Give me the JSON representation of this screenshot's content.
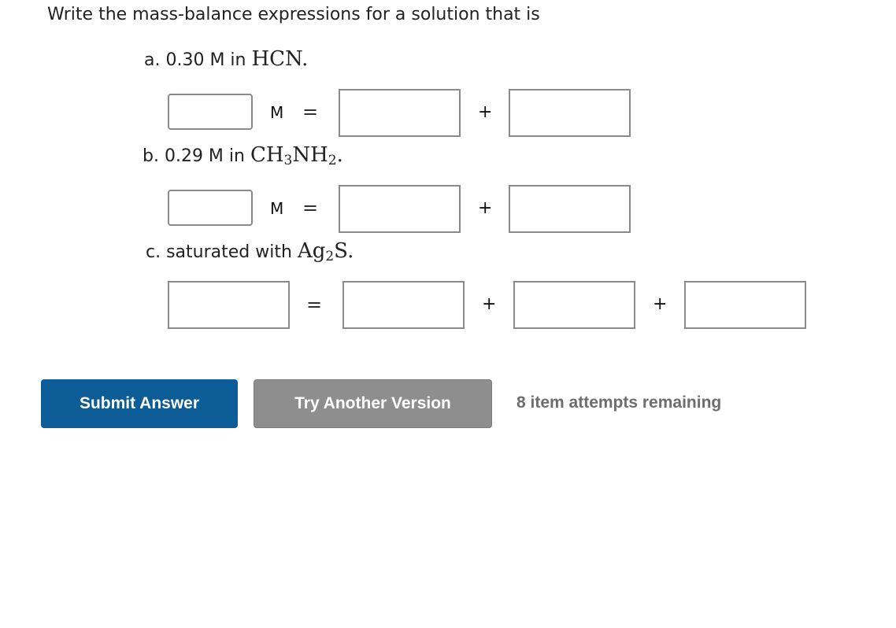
{
  "prompt": "Write the mass-balance expressions for a solution that is",
  "parts": {
    "a": {
      "label": "a. 0.30 M in ",
      "species": "HCN",
      "species_suffix": ".",
      "unit": "M",
      "equals": "=",
      "plus": "+"
    },
    "b": {
      "label": "b. 0.29 M in ",
      "species_part1": "CH",
      "species_sub1": "3",
      "species_part2": "NH",
      "species_sub2": "2",
      "species_suffix": ".",
      "unit": "M",
      "equals": "=",
      "plus": "+"
    },
    "c": {
      "label": "c. saturated with ",
      "species_part1": "Ag",
      "species_sub1": "2",
      "species_part2": "S",
      "species_suffix": ".",
      "equals": "=",
      "plus1": "+",
      "plus2": "+"
    }
  },
  "buttons": {
    "submit": "Submit Answer",
    "try_another": "Try Another Version"
  },
  "attempts_remaining": "8 item attempts remaining",
  "colors": {
    "submit_bg": "#0b5c97",
    "try_bg": "#8e8e8e",
    "attempts_text": "#6d6d6d"
  }
}
